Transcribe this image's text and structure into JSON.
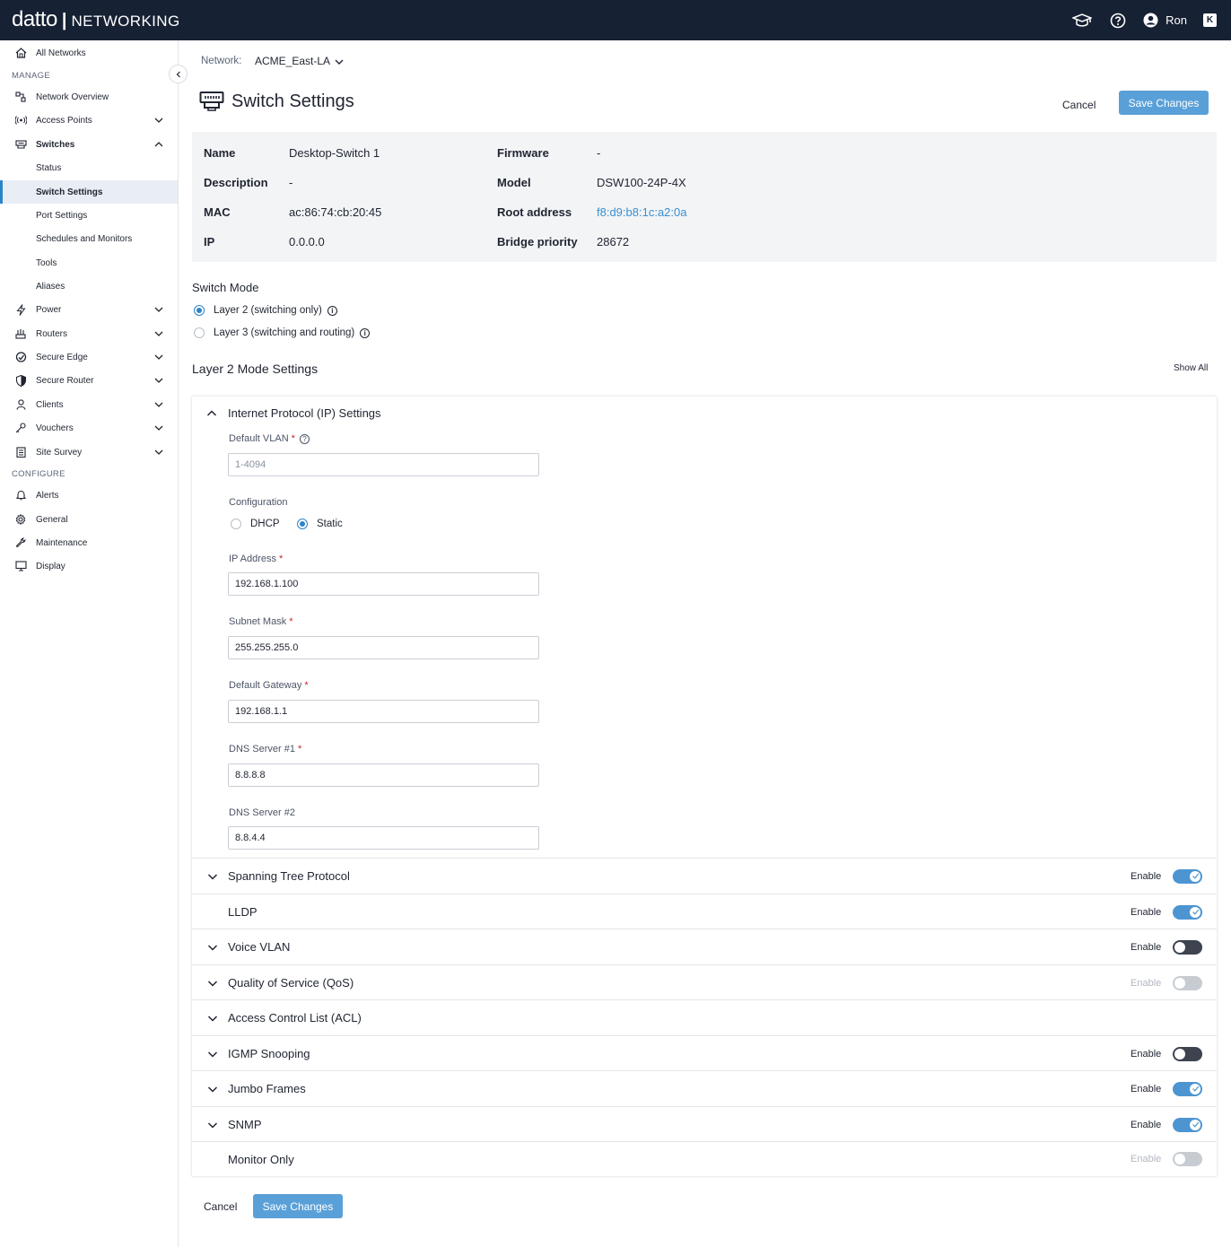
{
  "topbar": {
    "logo": "datto",
    "separator": "|",
    "product": "NETWORKING",
    "user": "Ron",
    "k_badge": "K",
    "icons": [
      "graduation-cap-icon",
      "help-icon",
      "user-avatar-icon",
      "k-icon"
    ]
  },
  "sidebar": {
    "all_networks": "All Networks",
    "manage_label": "MANAGE",
    "configure_label": "CONFIGURE",
    "items": {
      "network_overview": "Network Overview",
      "access_points": "Access Points",
      "switches": "Switches",
      "status": "Status",
      "switch_settings": "Switch Settings",
      "port_settings": "Port Settings",
      "schedules": "Schedules and Monitors",
      "tools": "Tools",
      "aliases": "Aliases",
      "power": "Power",
      "routers": "Routers",
      "secure_edge": "Secure Edge",
      "secure_router": "Secure Router",
      "clients": "Clients",
      "vouchers": "Vouchers",
      "site_survey": "Site Survey",
      "alerts": "Alerts",
      "general": "General",
      "maintenance": "Maintenance",
      "display": "Display"
    }
  },
  "header": {
    "network_label": "Network:",
    "network_value": "ACME_East-LA",
    "title": "Switch Settings",
    "cancel": "Cancel",
    "save": "Save Changes"
  },
  "info": {
    "name_k": "Name",
    "name_v": "Desktop-Switch 1",
    "desc_k": "Description",
    "desc_v": "-",
    "mac_k": "MAC",
    "mac_v": "ac:86:74:cb:20:45",
    "ip_k": "IP",
    "ip_v": "0.0.0.0",
    "fw_k": "Firmware",
    "fw_v": "-",
    "model_k": "Model",
    "model_v": "DSW100-24P-4X",
    "root_k": "Root address",
    "root_v": "f8:d9:b8:1c:a2:0a",
    "bridge_k": "Bridge priority",
    "bridge_v": "28672"
  },
  "switch_mode": {
    "title": "Switch Mode",
    "layer2": "Layer 2 (switching only)",
    "layer3": "Layer 3 (switching and routing)",
    "selected": "layer2"
  },
  "layer2": {
    "title": "Layer 2 Mode Settings",
    "show_all": "Show All"
  },
  "ip_settings": {
    "title": "Internet Protocol (IP) Settings",
    "default_vlan_label": "Default VLAN",
    "default_vlan_placeholder": "1-4094",
    "configuration_label": "Configuration",
    "dhcp": "DHCP",
    "static": "Static",
    "ip_label": "IP Address",
    "ip_value": "192.168.1.100",
    "subnet_label": "Subnet Mask",
    "subnet_value": "255.255.255.0",
    "gateway_label": "Default Gateway",
    "gateway_value": "192.168.1.1",
    "dns1_label": "DNS Server #1",
    "dns1_value": "8.8.8.8",
    "dns2_label": "DNS Server #2",
    "dns2_value": "8.8.4.4",
    "required_mark": "*",
    "help_mark": "?",
    "info_mark": "i"
  },
  "sections": {
    "enable_label": "Enable",
    "stp": "Spanning Tree Protocol",
    "lldp": "LLDP",
    "voice_vlan": "Voice VLAN",
    "qos": "Quality of Service (QoS)",
    "acl": "Access Control List (ACL)",
    "igmp": "IGMP Snooping",
    "jumbo": "Jumbo Frames",
    "snmp": "SNMP",
    "monitor": "Monitor Only"
  },
  "toggles": {
    "stp": true,
    "lldp": true,
    "voice_vlan": false,
    "qos": false,
    "igmp": false,
    "jumbo": true,
    "snmp": true,
    "monitor": false
  },
  "footer": {
    "cancel": "Cancel",
    "save": "Save Changes"
  },
  "colors": {
    "topbar": "#162133",
    "accent": "#2c84c8",
    "save_button": "#5aa0d8",
    "link": "#3a8fd0"
  }
}
